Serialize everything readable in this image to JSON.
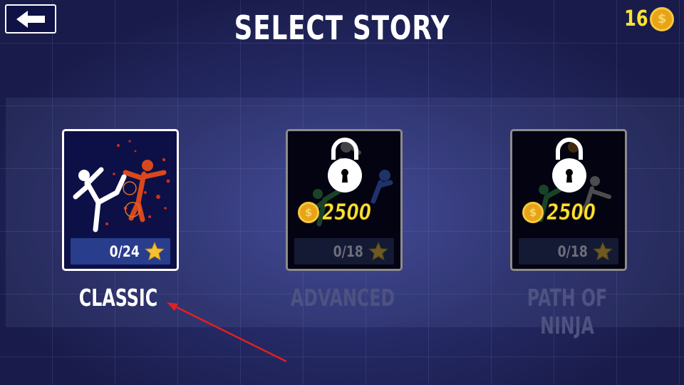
{
  "header": {
    "title": "SELECT STORY",
    "back_icon": "left-arrow-icon",
    "coin_count": "16",
    "coin_icon": "gold-coin-icon"
  },
  "stories": [
    {
      "name": "CLASSIC",
      "progress": "0/24",
      "locked": false
    },
    {
      "name": "ADVANCED",
      "progress": "0/18",
      "locked": true,
      "price": "2500"
    },
    {
      "name": "PATH OF NINJA",
      "progress": "0/18",
      "locked": true,
      "price": "2500"
    }
  ],
  "colors": {
    "background": "#252a66",
    "coin_text": "#ffe233",
    "arrow": "#e02020"
  }
}
